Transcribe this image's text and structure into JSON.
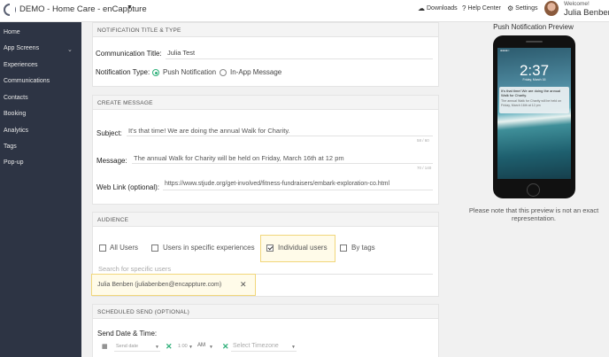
{
  "header": {
    "app_title": "DEMO - Home Care - enCappture",
    "downloads": "Downloads",
    "help": "Help Center",
    "settings": "Settings",
    "welcome": "Welcome!",
    "user_name": "Julia Benben"
  },
  "sidebar": {
    "items": [
      {
        "label": "Home"
      },
      {
        "label": "App Screens"
      },
      {
        "label": "Experiences"
      },
      {
        "label": "Communications"
      },
      {
        "label": "Contacts"
      },
      {
        "label": "Booking"
      },
      {
        "label": "Analytics"
      },
      {
        "label": "Tags"
      },
      {
        "label": "Pop-up"
      }
    ]
  },
  "notification": {
    "header": "NOTIFICATION TITLE & TYPE",
    "title_label": "Communication Title:",
    "title_value": "Julia Test",
    "type_label": "Notification Type:",
    "opt_push": "Push Notification",
    "opt_inapp": "In-App Message",
    "selected": "Push Notification"
  },
  "message": {
    "header": "CREATE MESSAGE",
    "subject_label": "Subject:",
    "subject_value": "It's that time!  We are doing the annual Walk for Charity.",
    "subject_count": "58 / 60",
    "message_label": "Message:",
    "message_value": "The annual Walk for Charity will be held on Friday, March 16th at 12 pm",
    "message_count": "70 / 140",
    "weblink_label": "Web Link (optional):",
    "weblink_value": "https://www.stjude.org/get-involved/fitness-fundraisers/embark-exploration-co.html"
  },
  "audience": {
    "header": "AUDIENCE",
    "opt_all": "All Users",
    "opt_exp": "Users in specific experiences",
    "opt_individual": "Individual users",
    "opt_tags": "By tags",
    "search_placeholder": "Search for specific users",
    "selected_user": "Julia Benben (juliabenben@encappture.com)"
  },
  "schedule": {
    "header": "SCHEDULED SEND (OPTIONAL)",
    "date_label": "Send Date & Time:",
    "date_placeholder": "Send date",
    "hour": "1:00",
    "ampm": "AM",
    "timezone_placeholder": "Select Timezone"
  },
  "preview": {
    "title": "Push Notification Preview",
    "clock": "2:37",
    "date": "Friday, March 16",
    "note": "Please note that this preview is not an exact representation."
  },
  "colors": {
    "sidebar_bg": "#2d3444",
    "accent_green": "#2fb07a",
    "highlight": "#f1d67a"
  }
}
